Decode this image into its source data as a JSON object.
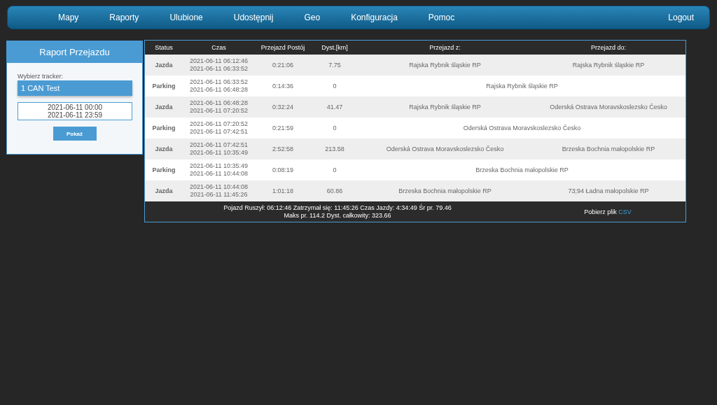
{
  "nav": {
    "items": [
      "Mapy",
      "Raporty",
      "Ulubione",
      "Udostępnij",
      "Geo",
      "Konfiguracja",
      "Pomoc"
    ],
    "logout": "Logout"
  },
  "panel": {
    "title": "Raport Przejazdu",
    "tracker_label": "Wybierz tracker:",
    "tracker_value": "1 CAN Test",
    "range": [
      "2021-06-11 00:00",
      "2021-06-11 23:59"
    ],
    "button": "Pokaż"
  },
  "table": {
    "columns": [
      "Status",
      "Czas",
      "Przejazd Postój",
      "Dyst.[km]",
      "Przejazd z:",
      "Przejazd do:"
    ],
    "rows": [
      {
        "kind": "drive",
        "status": "Jazda",
        "times": [
          "2021-06-11 06:12:46",
          "2021-06-11 06:33:52"
        ],
        "duration": "0:21:06",
        "distance": "7.75",
        "from": "Rajska Rybnik śląskie RP",
        "to": "Rajska Rybnik śląskie RP"
      },
      {
        "kind": "parking",
        "status": "Parking",
        "times": [
          "2021-06-11 06:33:52",
          "2021-06-11 06:48:28"
        ],
        "duration": "0:14:36",
        "distance": "0",
        "place": "Rajska Rybnik śląskie RP"
      },
      {
        "kind": "drive",
        "status": "Jazda",
        "times": [
          "2021-06-11 06:48:28",
          "2021-06-11 07:20:52"
        ],
        "duration": "0:32:24",
        "distance": "41.47",
        "from": "Rajska Rybnik śląskie RP",
        "to": "Oderská Ostrava Moravskoslezsko Česko"
      },
      {
        "kind": "parking",
        "status": "Parking",
        "times": [
          "2021-06-11 07:20:52",
          "2021-06-11 07:42:51"
        ],
        "duration": "0:21:59",
        "distance": "0",
        "place": "Oderská Ostrava Moravskoslezsko Česko"
      },
      {
        "kind": "drive",
        "status": "Jazda",
        "times": [
          "2021-06-11 07:42:51",
          "2021-06-11 10:35:49"
        ],
        "duration": "2:52:58",
        "distance": "213.58",
        "from": "Oderská Ostrava Moravskoslezsko Česko",
        "to": "Brzeska Bochnia małopolskie RP"
      },
      {
        "kind": "parking",
        "status": "Parking",
        "times": [
          "2021-06-11 10:35:49",
          "2021-06-11 10:44:08"
        ],
        "duration": "0:08:19",
        "distance": "0",
        "place": "Brzeska Bochnia małopolskie RP"
      },
      {
        "kind": "drive",
        "status": "Jazda",
        "times": [
          "2021-06-11 10:44:08",
          "2021-06-11 11:45:26"
        ],
        "duration": "1:01:18",
        "distance": "60.86",
        "from": "Brzeska Bochnia małopolskie RP",
        "to": "73;94 Ładna małopolskie RP"
      }
    ],
    "summary": [
      "Pojazd Ruszył: 06:12:46 Zatrzymał się: 11:45:26 Czas Jazdy: 4:34:49 Śr pr. 79.46",
      "Maks pr. 114.2 Dyst. całkowity: 323.66"
    ],
    "download_label": "Pobierz plik",
    "download_link": "CSV"
  }
}
